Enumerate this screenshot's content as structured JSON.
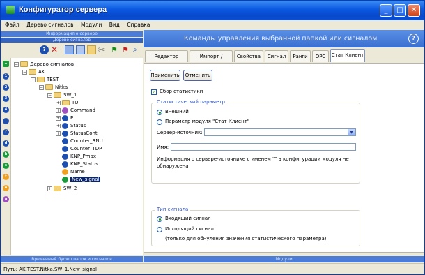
{
  "window": {
    "title": "Конфигуратор сервера"
  },
  "menu": [
    "Файл",
    "Дерево сигналов",
    "Модули",
    "Вид",
    "Справка"
  ],
  "left_panel": {
    "header_top": "Информация о сервере",
    "header_sub": "Дерево сигналов",
    "bottom_label": "Временный буфер папок и сигналов"
  },
  "tree": {
    "root": "Дерево сигналов",
    "ak": "AK",
    "test": "TEST",
    "nitka": "Nitka",
    "sw1": "SW_1",
    "items": [
      "TU",
      "Command",
      "P",
      "Status",
      "StatusContl",
      "Counter_RNU",
      "Counter_TDP",
      "KNP_Pmax",
      "KNP_Status",
      "Name",
      "New_signal"
    ],
    "sw2": "SW_2"
  },
  "right_panel": {
    "header": "Команды управления выбранной папкой или сигналом",
    "help": "?",
    "tabs": [
      "Редактор адреса",
      "Импорт / Экспорт",
      "Свойства",
      "Сигнал",
      "Ранги",
      "OPC",
      "Стат Клиент"
    ],
    "active_tab": "Стат Клиент",
    "apply": "Применить",
    "cancel": "Отменить",
    "collect_stats": "Сбор статистики",
    "stat_group": "Статистический параметр",
    "external": "Внешний",
    "module_param": "Параметр модуля \"Стат Клиент\"",
    "server_source": "Сервер-источник:",
    "name_label": "Имя:",
    "info": "Информация о сервере-источнике с именем \"\" в конфигурации модуля не обнаружена",
    "signal_type_group": "Тип сигнала",
    "incoming": "Входящий сигнал",
    "outgoing": "Исходящий сигнал",
    "outgoing_note": "(только для обнуления значения статистического параметра)",
    "bottom_label": "Модули"
  },
  "status": {
    "path": "Путь: AK.TEST.Nitka.SW_1.New_signal"
  },
  "colors": {
    "accent": "#3a6fd0",
    "titlebar": "#0a58e0"
  }
}
